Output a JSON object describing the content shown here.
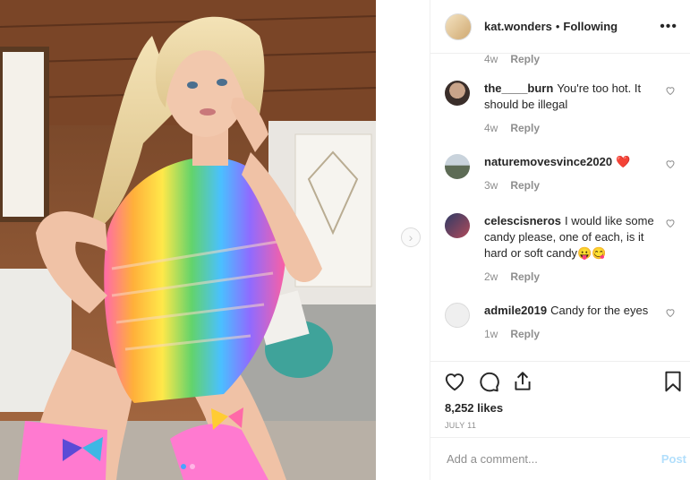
{
  "post": {
    "username": "kat.wonders",
    "separator": "•",
    "follow_status": "Following",
    "more_icon": "more-options-icon"
  },
  "partial_comment": {
    "time": "4w",
    "reply": "Reply"
  },
  "comments": [
    {
      "username": "the____burn",
      "text": "You're too hot. It should be illegal",
      "time": "4w",
      "reply": "Reply",
      "avatar_color": "#3a2e2a"
    },
    {
      "username": "naturemovesvince2020",
      "text": "❤️",
      "time": "3w",
      "reply": "Reply",
      "avatar_color": "#7c8a96"
    },
    {
      "username": "celescisneros",
      "text": "I would like some candy please, one of each, is it hard or soft candy😛😋",
      "time": "2w",
      "reply": "Reply",
      "avatar_color": "#5a6a8a"
    },
    {
      "username": "admile2019",
      "text": "Candy for the eyes",
      "time": "1w",
      "reply": "Reply",
      "avatar_color": "#dbdbdb"
    }
  ],
  "engagement": {
    "likes": "8,252 likes",
    "date": "JULY 11"
  },
  "composer": {
    "placeholder": "Add a comment...",
    "post_label": "Post"
  },
  "carousel": {
    "slides": 2,
    "active": 1,
    "next_icon": "chevron-right-icon"
  },
  "colors": {
    "accent_disabled": "#b2dffc",
    "heart_red": "#ed4956",
    "active_dot": "#4aa3ff"
  }
}
